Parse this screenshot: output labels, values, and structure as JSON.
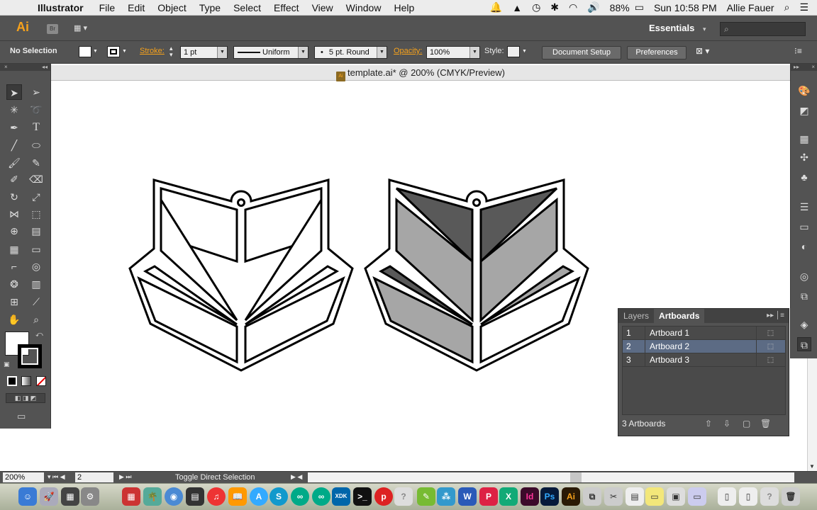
{
  "menubar": {
    "app": "Illustrator",
    "items": [
      "File",
      "Edit",
      "Object",
      "Type",
      "Select",
      "Effect",
      "View",
      "Window",
      "Help"
    ],
    "battery": "88%",
    "clock": "Sun 10:58 PM",
    "user": "Allie Fauer"
  },
  "appbar": {
    "logo": "Ai",
    "bridge": "Br",
    "workspace": "Essentials"
  },
  "control": {
    "selection": "No Selection",
    "stroke_label": "Stroke:",
    "stroke_weight": "1 pt",
    "profile": "Uniform",
    "brush": "5 pt. Round",
    "opacity_label": "Opacity:",
    "opacity": "100%",
    "style_label": "Style:",
    "document_setup": "Document Setup",
    "preferences": "Preferences"
  },
  "document": {
    "title": "template.ai* @ 200% (CMYK/Preview)",
    "colors": {
      "outline": "#000000",
      "light_gray": "#a6a6a6",
      "dark_gray": "#595959"
    }
  },
  "artboards_panel": {
    "tabs": [
      "Layers",
      "Artboards"
    ],
    "rows": [
      {
        "num": "1",
        "name": "Artboard 1"
      },
      {
        "num": "2",
        "name": "Artboard 2"
      },
      {
        "num": "3",
        "name": "Artboard 3"
      }
    ],
    "count": "3 Artboards"
  },
  "status": {
    "zoom": "200%",
    "page": "2",
    "tool_text": "Toggle Direct Selection"
  }
}
